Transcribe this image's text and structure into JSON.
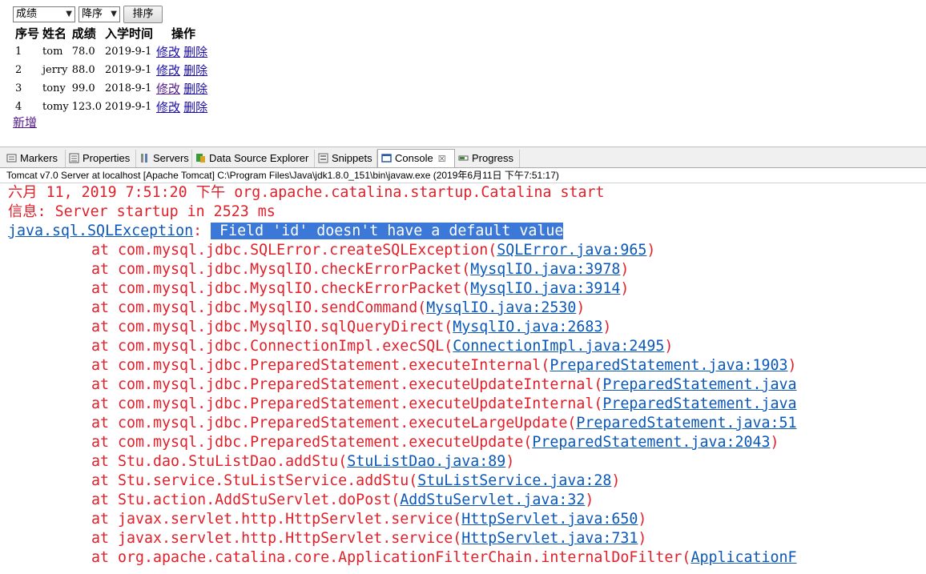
{
  "web": {
    "sort_field": "成绩",
    "sort_order": "降序",
    "sort_button": "排序",
    "headers": [
      "序号",
      "姓名",
      "成绩",
      "入学时间",
      "操作"
    ],
    "rows": [
      {
        "id": "1",
        "name": "tom",
        "score": "78.0",
        "date": "2019-9-1",
        "edit": "修改",
        "del": "删除"
      },
      {
        "id": "2",
        "name": "jerry",
        "score": "88.0",
        "date": "2019-9-1",
        "edit": "修改",
        "del": "删除"
      },
      {
        "id": "3",
        "name": "tony",
        "score": "99.0",
        "date": "2018-9-1",
        "edit": "修改",
        "del": "删除"
      },
      {
        "id": "4",
        "name": "tomy",
        "score": "123.0",
        "date": "2019-9-1",
        "edit": "修改",
        "del": "删除"
      }
    ],
    "add_link": "新增"
  },
  "tabs": {
    "markers": "Markers",
    "properties": "Properties",
    "servers": "Servers",
    "datasource": "Data Source Explorer",
    "snippets": "Snippets",
    "console": "Console",
    "console_close": "☒",
    "progress": "Progress"
  },
  "console_title": "Tomcat v7.0 Server at localhost [Apache Tomcat] C:\\Program Files\\Java\\jdk1.8.0_151\\bin\\javaw.exe (2019年6月11日 下午7:51:17)",
  "console": {
    "l1": "六月 11, 2019 7:51:20 下午 org.apache.catalina.startup.Catalina start",
    "l2": "信息: Server startup in 2523 ms",
    "ex_name": "java.sql.SQLException",
    "ex_sep": ": ",
    "ex_msg": " Field 'id' doesn't have a default value",
    "trace": [
      {
        "m": "at com.mysql.jdbc.SQLError.createSQLException",
        "s": "SQLError.java:965",
        "c": ")"
      },
      {
        "m": "at com.mysql.jdbc.MysqlIO.checkErrorPacket",
        "s": "MysqlIO.java:3978",
        "c": ")"
      },
      {
        "m": "at com.mysql.jdbc.MysqlIO.checkErrorPacket",
        "s": "MysqlIO.java:3914",
        "c": ")"
      },
      {
        "m": "at com.mysql.jdbc.MysqlIO.sendCommand",
        "s": "MysqlIO.java:2530",
        "c": ")"
      },
      {
        "m": "at com.mysql.jdbc.MysqlIO.sqlQueryDirect",
        "s": "MysqlIO.java:2683",
        "c": ")"
      },
      {
        "m": "at com.mysql.jdbc.ConnectionImpl.execSQL",
        "s": "ConnectionImpl.java:2495",
        "c": ")"
      },
      {
        "m": "at com.mysql.jdbc.PreparedStatement.executeInternal",
        "s": "PreparedStatement.java:1903",
        "c": ")"
      },
      {
        "m": "at com.mysql.jdbc.PreparedStatement.executeUpdateInternal",
        "s": "PreparedStatement.java",
        "c": ""
      },
      {
        "m": "at com.mysql.jdbc.PreparedStatement.executeUpdateInternal",
        "s": "PreparedStatement.java",
        "c": ""
      },
      {
        "m": "at com.mysql.jdbc.PreparedStatement.executeLargeUpdate",
        "s": "PreparedStatement.java:51",
        "c": ""
      },
      {
        "m": "at com.mysql.jdbc.PreparedStatement.executeUpdate",
        "s": "PreparedStatement.java:2043",
        "c": ")"
      },
      {
        "m": "at Stu.dao.StuListDao.addStu",
        "s": "StuListDao.java:89",
        "c": ")"
      },
      {
        "m": "at Stu.service.StuListService.addStu",
        "s": "StuListService.java:28",
        "c": ")"
      },
      {
        "m": "at Stu.action.AddStuServlet.doPost",
        "s": "AddStuServlet.java:32",
        "c": ")"
      },
      {
        "m": "at javax.servlet.http.HttpServlet.service",
        "s": "HttpServlet.java:650",
        "c": ")"
      },
      {
        "m": "at javax.servlet.http.HttpServlet.service",
        "s": "HttpServlet.java:731",
        "c": ")"
      },
      {
        "m": "at org.apache.catalina.core.ApplicationFilterChain.internalDoFilter",
        "s": "ApplicationF",
        "c": ""
      }
    ]
  }
}
